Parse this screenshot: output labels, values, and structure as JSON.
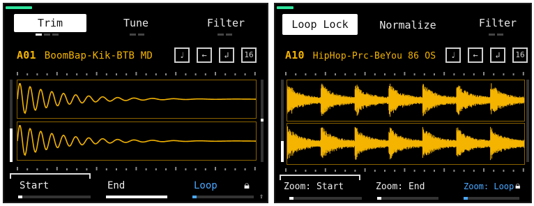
{
  "left": {
    "tabs": [
      "Trim",
      "Tune",
      "Filter"
    ],
    "slot": "A01",
    "sample_name": "BoomBap-Kik-BTB MD",
    "buttons": [
      "note-icon",
      "back-arrow-icon",
      "return-icon",
      "16"
    ],
    "controls": {
      "start": "Start",
      "end": "End",
      "loop": "Loop"
    }
  },
  "right": {
    "tabs": [
      "Loop Lock",
      "Normalize",
      "Filter"
    ],
    "slot": "A10",
    "sample_name": "HipHop-Prc-BeYou 86 OS",
    "buttons": [
      "note-icon",
      "back-arrow-icon",
      "return-icon",
      "16"
    ],
    "controls": {
      "start": "Zoom: Start",
      "end": "Zoom: End",
      "loop": "Zoom: Loop"
    }
  },
  "colors": {
    "wave": "#f4b400",
    "accent": "#2ee59d",
    "loop": "#4aa8ff"
  }
}
